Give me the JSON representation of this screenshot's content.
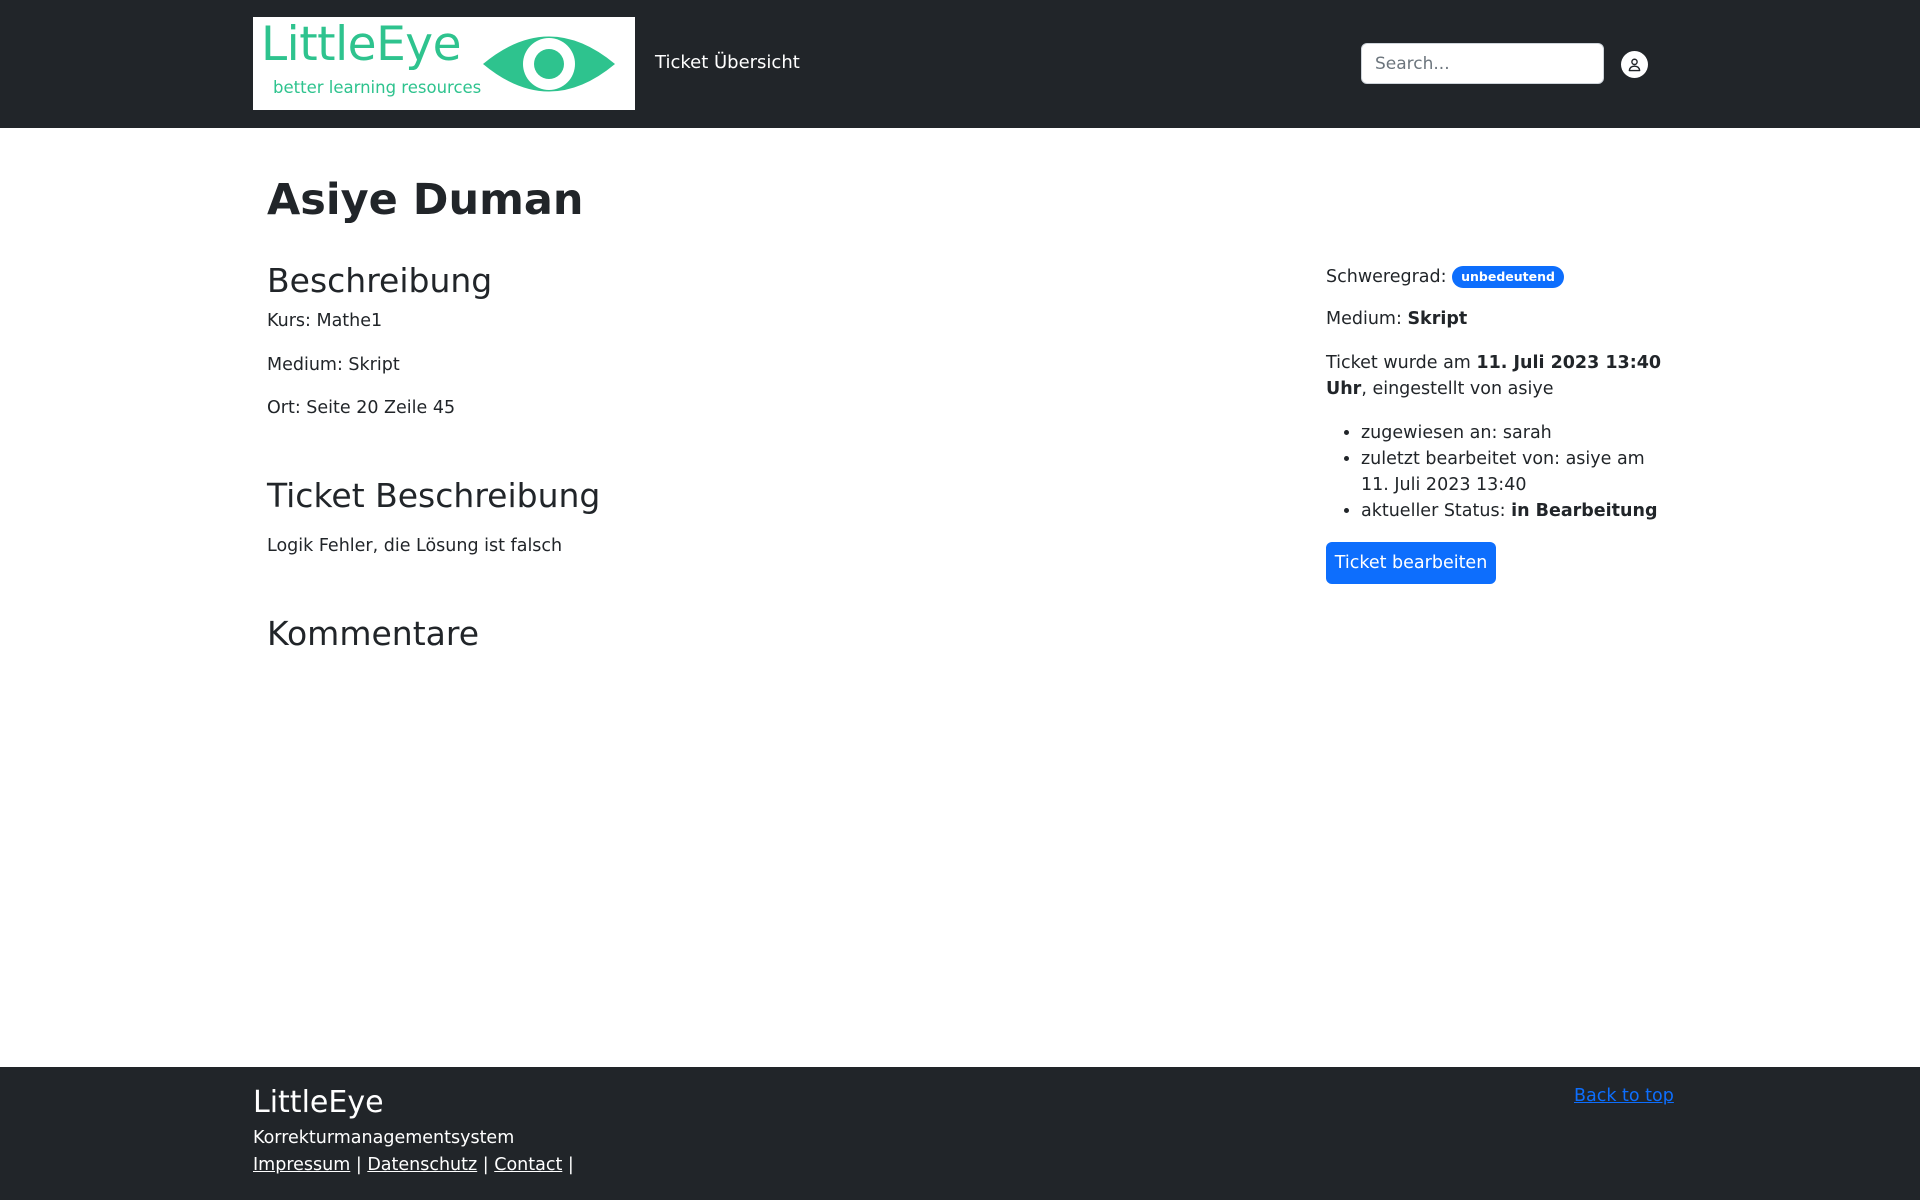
{
  "header": {
    "logo_title": "LittleEye",
    "logo_tagline": "better learning resources",
    "nav_link": "Ticket Übersicht",
    "search_placeholder": "Search..."
  },
  "ticket": {
    "title": "Asiye Duman",
    "description_heading": "Beschreibung",
    "kurs": "Kurs: Mathe1",
    "medium": "Medium: Skript",
    "ort": "Ort: Seite 20 Zeile 45",
    "ticket_description_heading": "Ticket Beschreibung",
    "ticket_description": "Logik Fehler, die Lösung ist falsch",
    "comments_heading": "Kommentare"
  },
  "sidebar": {
    "severity_label": "Schweregrad:",
    "severity_value": "unbedeutend",
    "medium_label": "Medium:",
    "medium_value": "Skript",
    "created_prefix": "Ticket wurde am",
    "created_date": "11. Juli 2023 13:40",
    "created_uhr": "Uhr",
    "created_suffix": ", eingestellt von asiye",
    "assigned": "zugewiesen an: sarah",
    "last_edited": "zuletzt bearbeitet von: asiye am 11. Juli 2023 13:40",
    "status_label": "aktueller Status:",
    "status_value": "in Bearbeitung",
    "edit_button": "Ticket bearbeiten"
  },
  "footer": {
    "brand": "LittleEye",
    "subtitle": "Korrekturmanagementsystem",
    "links": [
      "Impressum",
      "Datenschutz",
      "Contact"
    ],
    "back_to_top": "Back to top"
  },
  "colors": {
    "navbar": "#212529",
    "logo_green": "#2ec38e",
    "primary": "#0d6efd"
  },
  "icons": {
    "logo": "eye-icon",
    "user": "user-icon"
  }
}
